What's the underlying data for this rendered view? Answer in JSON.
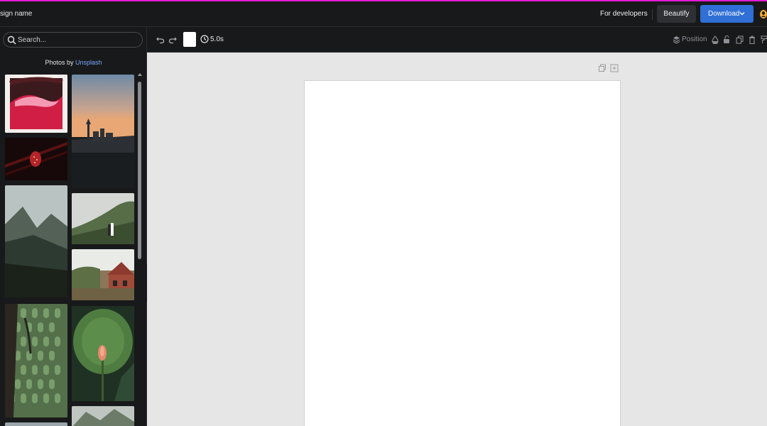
{
  "header": {
    "design_name": "sign name",
    "for_developers": "For developers",
    "beautify": "Beautify",
    "download": "Download",
    "accent_color": "#e31ad6",
    "download_color": "#2f6fd6"
  },
  "sidebar": {
    "search_placeholder": "Search...",
    "photos_by": "Photos by",
    "source": "Unsplash",
    "thumbnails": [
      "pink-red-abstract-artwork",
      "city-skyline-sunset",
      "strawberry-on-dark-background",
      "mountain-valley-landscape",
      "couple-on-misty-hill",
      "red-brick-house-garden",
      "green-textured-facade",
      "lotus-bud-with-leaf",
      "rocky-mountain-peak",
      "partial-thumbnail"
    ]
  },
  "toolbar": {
    "duration": "5.0s",
    "position": "Position",
    "icons": [
      "undo-icon",
      "redo-icon",
      "clock-icon",
      "layers-icon",
      "opacity-icon",
      "lock-icon",
      "duplicate-icon",
      "trash-icon",
      "paint-roller-icon"
    ]
  },
  "canvas": {
    "background_color": "#e6e6e6",
    "page_color": "#ffffff"
  }
}
